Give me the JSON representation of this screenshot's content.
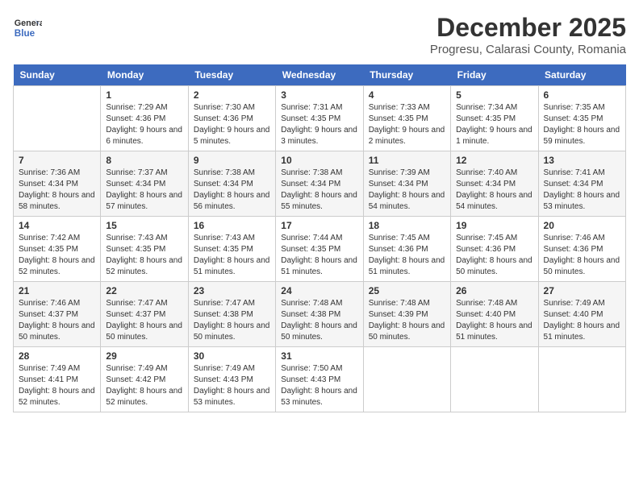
{
  "header": {
    "logo_line1": "General",
    "logo_line2": "Blue",
    "month": "December 2025",
    "location": "Progresu, Calarasi County, Romania"
  },
  "weekdays": [
    "Sunday",
    "Monday",
    "Tuesday",
    "Wednesday",
    "Thursday",
    "Friday",
    "Saturday"
  ],
  "weeks": [
    [
      {
        "day": "",
        "sunrise": "",
        "sunset": "",
        "daylight": ""
      },
      {
        "day": "1",
        "sunrise": "Sunrise: 7:29 AM",
        "sunset": "Sunset: 4:36 PM",
        "daylight": "Daylight: 9 hours and 6 minutes."
      },
      {
        "day": "2",
        "sunrise": "Sunrise: 7:30 AM",
        "sunset": "Sunset: 4:36 PM",
        "daylight": "Daylight: 9 hours and 5 minutes."
      },
      {
        "day": "3",
        "sunrise": "Sunrise: 7:31 AM",
        "sunset": "Sunset: 4:35 PM",
        "daylight": "Daylight: 9 hours and 3 minutes."
      },
      {
        "day": "4",
        "sunrise": "Sunrise: 7:33 AM",
        "sunset": "Sunset: 4:35 PM",
        "daylight": "Daylight: 9 hours and 2 minutes."
      },
      {
        "day": "5",
        "sunrise": "Sunrise: 7:34 AM",
        "sunset": "Sunset: 4:35 PM",
        "daylight": "Daylight: 9 hours and 1 minute."
      },
      {
        "day": "6",
        "sunrise": "Sunrise: 7:35 AM",
        "sunset": "Sunset: 4:35 PM",
        "daylight": "Daylight: 8 hours and 59 minutes."
      }
    ],
    [
      {
        "day": "7",
        "sunrise": "Sunrise: 7:36 AM",
        "sunset": "Sunset: 4:34 PM",
        "daylight": "Daylight: 8 hours and 58 minutes."
      },
      {
        "day": "8",
        "sunrise": "Sunrise: 7:37 AM",
        "sunset": "Sunset: 4:34 PM",
        "daylight": "Daylight: 8 hours and 57 minutes."
      },
      {
        "day": "9",
        "sunrise": "Sunrise: 7:38 AM",
        "sunset": "Sunset: 4:34 PM",
        "daylight": "Daylight: 8 hours and 56 minutes."
      },
      {
        "day": "10",
        "sunrise": "Sunrise: 7:38 AM",
        "sunset": "Sunset: 4:34 PM",
        "daylight": "Daylight: 8 hours and 55 minutes."
      },
      {
        "day": "11",
        "sunrise": "Sunrise: 7:39 AM",
        "sunset": "Sunset: 4:34 PM",
        "daylight": "Daylight: 8 hours and 54 minutes."
      },
      {
        "day": "12",
        "sunrise": "Sunrise: 7:40 AM",
        "sunset": "Sunset: 4:34 PM",
        "daylight": "Daylight: 8 hours and 54 minutes."
      },
      {
        "day": "13",
        "sunrise": "Sunrise: 7:41 AM",
        "sunset": "Sunset: 4:34 PM",
        "daylight": "Daylight: 8 hours and 53 minutes."
      }
    ],
    [
      {
        "day": "14",
        "sunrise": "Sunrise: 7:42 AM",
        "sunset": "Sunset: 4:35 PM",
        "daylight": "Daylight: 8 hours and 52 minutes."
      },
      {
        "day": "15",
        "sunrise": "Sunrise: 7:43 AM",
        "sunset": "Sunset: 4:35 PM",
        "daylight": "Daylight: 8 hours and 52 minutes."
      },
      {
        "day": "16",
        "sunrise": "Sunrise: 7:43 AM",
        "sunset": "Sunset: 4:35 PM",
        "daylight": "Daylight: 8 hours and 51 minutes."
      },
      {
        "day": "17",
        "sunrise": "Sunrise: 7:44 AM",
        "sunset": "Sunset: 4:35 PM",
        "daylight": "Daylight: 8 hours and 51 minutes."
      },
      {
        "day": "18",
        "sunrise": "Sunrise: 7:45 AM",
        "sunset": "Sunset: 4:36 PM",
        "daylight": "Daylight: 8 hours and 51 minutes."
      },
      {
        "day": "19",
        "sunrise": "Sunrise: 7:45 AM",
        "sunset": "Sunset: 4:36 PM",
        "daylight": "Daylight: 8 hours and 50 minutes."
      },
      {
        "day": "20",
        "sunrise": "Sunrise: 7:46 AM",
        "sunset": "Sunset: 4:36 PM",
        "daylight": "Daylight: 8 hours and 50 minutes."
      }
    ],
    [
      {
        "day": "21",
        "sunrise": "Sunrise: 7:46 AM",
        "sunset": "Sunset: 4:37 PM",
        "daylight": "Daylight: 8 hours and 50 minutes."
      },
      {
        "day": "22",
        "sunrise": "Sunrise: 7:47 AM",
        "sunset": "Sunset: 4:37 PM",
        "daylight": "Daylight: 8 hours and 50 minutes."
      },
      {
        "day": "23",
        "sunrise": "Sunrise: 7:47 AM",
        "sunset": "Sunset: 4:38 PM",
        "daylight": "Daylight: 8 hours and 50 minutes."
      },
      {
        "day": "24",
        "sunrise": "Sunrise: 7:48 AM",
        "sunset": "Sunset: 4:38 PM",
        "daylight": "Daylight: 8 hours and 50 minutes."
      },
      {
        "day": "25",
        "sunrise": "Sunrise: 7:48 AM",
        "sunset": "Sunset: 4:39 PM",
        "daylight": "Daylight: 8 hours and 50 minutes."
      },
      {
        "day": "26",
        "sunrise": "Sunrise: 7:48 AM",
        "sunset": "Sunset: 4:40 PM",
        "daylight": "Daylight: 8 hours and 51 minutes."
      },
      {
        "day": "27",
        "sunrise": "Sunrise: 7:49 AM",
        "sunset": "Sunset: 4:40 PM",
        "daylight": "Daylight: 8 hours and 51 minutes."
      }
    ],
    [
      {
        "day": "28",
        "sunrise": "Sunrise: 7:49 AM",
        "sunset": "Sunset: 4:41 PM",
        "daylight": "Daylight: 8 hours and 52 minutes."
      },
      {
        "day": "29",
        "sunrise": "Sunrise: 7:49 AM",
        "sunset": "Sunset: 4:42 PM",
        "daylight": "Daylight: 8 hours and 52 minutes."
      },
      {
        "day": "30",
        "sunrise": "Sunrise: 7:49 AM",
        "sunset": "Sunset: 4:43 PM",
        "daylight": "Daylight: 8 hours and 53 minutes."
      },
      {
        "day": "31",
        "sunrise": "Sunrise: 7:50 AM",
        "sunset": "Sunset: 4:43 PM",
        "daylight": "Daylight: 8 hours and 53 minutes."
      },
      {
        "day": "",
        "sunrise": "",
        "sunset": "",
        "daylight": ""
      },
      {
        "day": "",
        "sunrise": "",
        "sunset": "",
        "daylight": ""
      },
      {
        "day": "",
        "sunrise": "",
        "sunset": "",
        "daylight": ""
      }
    ]
  ]
}
